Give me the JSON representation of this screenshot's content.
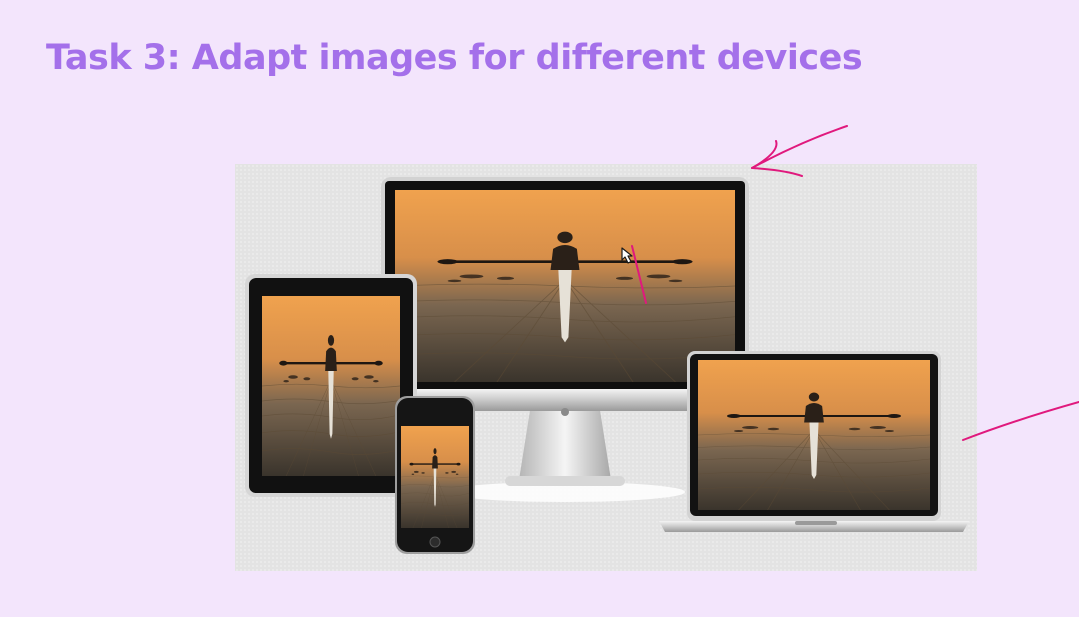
{
  "slide": {
    "title": "Task 3: Adapt images for different devices"
  },
  "image": {
    "subject": "rower-on-sunset-lake-photo",
    "devices": [
      "monitor",
      "tablet",
      "phone",
      "laptop"
    ]
  },
  "colors": {
    "background": "#f3e5fc",
    "title": "#a470ea",
    "annotation_ink": "#e0197d",
    "photo_backdrop": "#e3e3e3"
  },
  "icons": {
    "cursor": "pointer-hand-icon"
  }
}
